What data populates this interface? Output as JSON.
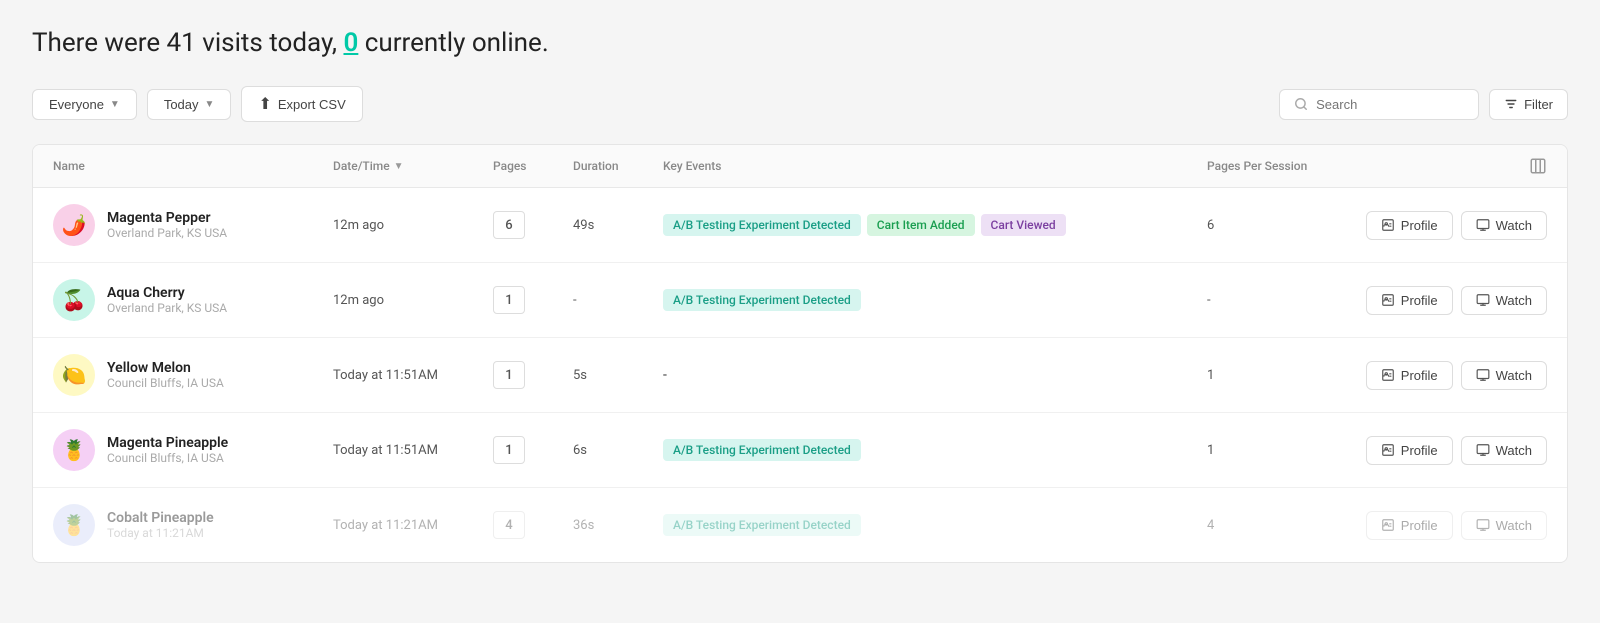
{
  "headline": {
    "prefix": "There were 41 visits today,",
    "highlight": "0",
    "suffix": "currently online."
  },
  "toolbar": {
    "everyone_label": "Everyone",
    "today_label": "Today",
    "export_label": "Export CSV",
    "search_placeholder": "Search",
    "filter_label": "Filter"
  },
  "table": {
    "columns": {
      "name": "Name",
      "datetime": "Date/Time",
      "pages": "Pages",
      "duration": "Duration",
      "key_events": "Key Events",
      "pages_per_session": "Pages Per Session"
    },
    "rows": [
      {
        "id": "magenta-pepper",
        "avatar_emoji": "🌶️",
        "avatar_class": "avatar-magenta-pepper",
        "name": "Magenta Pepper",
        "location": "Overland Park, KS USA",
        "datetime": "12m ago",
        "pages": "6",
        "duration": "49s",
        "key_events": [
          {
            "label": "A/B Testing Experiment Detected",
            "type": "teal"
          },
          {
            "label": "Cart Item Added",
            "type": "green"
          },
          {
            "label": "Cart Viewed",
            "type": "purple"
          }
        ],
        "pages_per_session": "6",
        "faded": false
      },
      {
        "id": "aqua-cherry",
        "avatar_emoji": "🍒",
        "avatar_class": "avatar-aqua-cherry",
        "name": "Aqua Cherry",
        "location": "Overland Park, KS USA",
        "datetime": "12m ago",
        "pages": "1",
        "duration": "-",
        "key_events": [
          {
            "label": "A/B Testing Experiment Detected",
            "type": "teal"
          }
        ],
        "pages_per_session": "-",
        "faded": false
      },
      {
        "id": "yellow-melon",
        "avatar_emoji": "🍋",
        "avatar_class": "avatar-yellow-melon",
        "name": "Yellow Melon",
        "location": "Council Bluffs, IA USA",
        "datetime": "Today at 11:51AM",
        "pages": "1",
        "duration": "5s",
        "key_events": [],
        "pages_per_session": "1",
        "faded": false
      },
      {
        "id": "magenta-pineapple",
        "avatar_emoji": "🍍",
        "avatar_class": "avatar-magenta-pineapple",
        "name": "Magenta Pineapple",
        "location": "Council Bluffs, IA USA",
        "datetime": "Today at 11:51AM",
        "pages": "1",
        "duration": "6s",
        "key_events": [
          {
            "label": "A/B Testing Experiment Detected",
            "type": "teal"
          }
        ],
        "pages_per_session": "1",
        "faded": false
      },
      {
        "id": "cobalt-pineapple",
        "avatar_emoji": "🍍",
        "avatar_class": "avatar-cobalt-pineapple",
        "name": "Cobalt Pineapple",
        "location": "Today at 11:21AM",
        "datetime": "Today at 11:21AM",
        "pages": "4",
        "duration": "36s",
        "key_events": [
          {
            "label": "A/B Testing Experiment Detected",
            "type": "teal"
          }
        ],
        "pages_per_session": "4",
        "faded": true
      }
    ],
    "actions": {
      "profile_label": "Profile",
      "watch_label": "Watch"
    }
  }
}
